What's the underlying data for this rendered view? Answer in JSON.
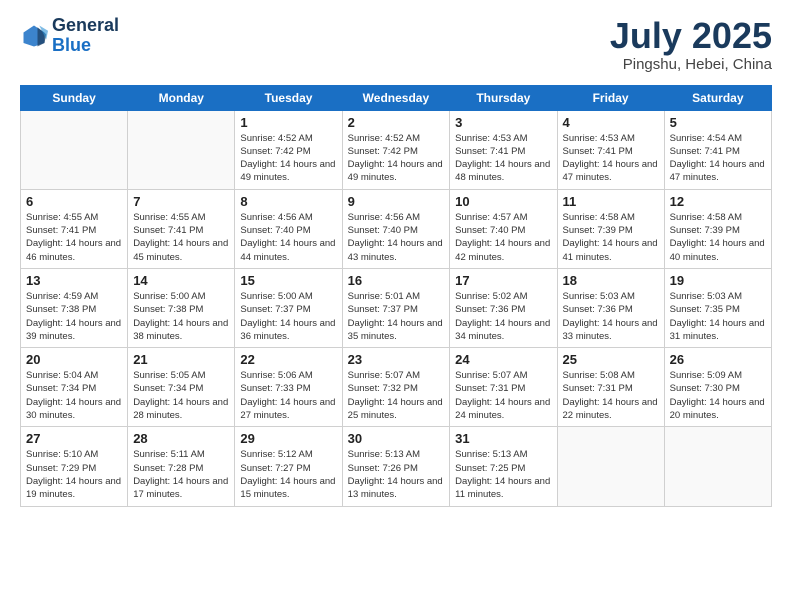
{
  "logo": {
    "general": "General",
    "blue": "Blue"
  },
  "title": {
    "month_year": "July 2025",
    "location": "Pingshu, Hebei, China"
  },
  "weekdays": [
    "Sunday",
    "Monday",
    "Tuesday",
    "Wednesday",
    "Thursday",
    "Friday",
    "Saturday"
  ],
  "weeks": [
    [
      {
        "day": "",
        "info": ""
      },
      {
        "day": "",
        "info": ""
      },
      {
        "day": "1",
        "info": "Sunrise: 4:52 AM\nSunset: 7:42 PM\nDaylight: 14 hours and 49 minutes."
      },
      {
        "day": "2",
        "info": "Sunrise: 4:52 AM\nSunset: 7:42 PM\nDaylight: 14 hours and 49 minutes."
      },
      {
        "day": "3",
        "info": "Sunrise: 4:53 AM\nSunset: 7:41 PM\nDaylight: 14 hours and 48 minutes."
      },
      {
        "day": "4",
        "info": "Sunrise: 4:53 AM\nSunset: 7:41 PM\nDaylight: 14 hours and 47 minutes."
      },
      {
        "day": "5",
        "info": "Sunrise: 4:54 AM\nSunset: 7:41 PM\nDaylight: 14 hours and 47 minutes."
      }
    ],
    [
      {
        "day": "6",
        "info": "Sunrise: 4:55 AM\nSunset: 7:41 PM\nDaylight: 14 hours and 46 minutes."
      },
      {
        "day": "7",
        "info": "Sunrise: 4:55 AM\nSunset: 7:41 PM\nDaylight: 14 hours and 45 minutes."
      },
      {
        "day": "8",
        "info": "Sunrise: 4:56 AM\nSunset: 7:40 PM\nDaylight: 14 hours and 44 minutes."
      },
      {
        "day": "9",
        "info": "Sunrise: 4:56 AM\nSunset: 7:40 PM\nDaylight: 14 hours and 43 minutes."
      },
      {
        "day": "10",
        "info": "Sunrise: 4:57 AM\nSunset: 7:40 PM\nDaylight: 14 hours and 42 minutes."
      },
      {
        "day": "11",
        "info": "Sunrise: 4:58 AM\nSunset: 7:39 PM\nDaylight: 14 hours and 41 minutes."
      },
      {
        "day": "12",
        "info": "Sunrise: 4:58 AM\nSunset: 7:39 PM\nDaylight: 14 hours and 40 minutes."
      }
    ],
    [
      {
        "day": "13",
        "info": "Sunrise: 4:59 AM\nSunset: 7:38 PM\nDaylight: 14 hours and 39 minutes."
      },
      {
        "day": "14",
        "info": "Sunrise: 5:00 AM\nSunset: 7:38 PM\nDaylight: 14 hours and 38 minutes."
      },
      {
        "day": "15",
        "info": "Sunrise: 5:00 AM\nSunset: 7:37 PM\nDaylight: 14 hours and 36 minutes."
      },
      {
        "day": "16",
        "info": "Sunrise: 5:01 AM\nSunset: 7:37 PM\nDaylight: 14 hours and 35 minutes."
      },
      {
        "day": "17",
        "info": "Sunrise: 5:02 AM\nSunset: 7:36 PM\nDaylight: 14 hours and 34 minutes."
      },
      {
        "day": "18",
        "info": "Sunrise: 5:03 AM\nSunset: 7:36 PM\nDaylight: 14 hours and 33 minutes."
      },
      {
        "day": "19",
        "info": "Sunrise: 5:03 AM\nSunset: 7:35 PM\nDaylight: 14 hours and 31 minutes."
      }
    ],
    [
      {
        "day": "20",
        "info": "Sunrise: 5:04 AM\nSunset: 7:34 PM\nDaylight: 14 hours and 30 minutes."
      },
      {
        "day": "21",
        "info": "Sunrise: 5:05 AM\nSunset: 7:34 PM\nDaylight: 14 hours and 28 minutes."
      },
      {
        "day": "22",
        "info": "Sunrise: 5:06 AM\nSunset: 7:33 PM\nDaylight: 14 hours and 27 minutes."
      },
      {
        "day": "23",
        "info": "Sunrise: 5:07 AM\nSunset: 7:32 PM\nDaylight: 14 hours and 25 minutes."
      },
      {
        "day": "24",
        "info": "Sunrise: 5:07 AM\nSunset: 7:31 PM\nDaylight: 14 hours and 24 minutes."
      },
      {
        "day": "25",
        "info": "Sunrise: 5:08 AM\nSunset: 7:31 PM\nDaylight: 14 hours and 22 minutes."
      },
      {
        "day": "26",
        "info": "Sunrise: 5:09 AM\nSunset: 7:30 PM\nDaylight: 14 hours and 20 minutes."
      }
    ],
    [
      {
        "day": "27",
        "info": "Sunrise: 5:10 AM\nSunset: 7:29 PM\nDaylight: 14 hours and 19 minutes."
      },
      {
        "day": "28",
        "info": "Sunrise: 5:11 AM\nSunset: 7:28 PM\nDaylight: 14 hours and 17 minutes."
      },
      {
        "day": "29",
        "info": "Sunrise: 5:12 AM\nSunset: 7:27 PM\nDaylight: 14 hours and 15 minutes."
      },
      {
        "day": "30",
        "info": "Sunrise: 5:13 AM\nSunset: 7:26 PM\nDaylight: 14 hours and 13 minutes."
      },
      {
        "day": "31",
        "info": "Sunrise: 5:13 AM\nSunset: 7:25 PM\nDaylight: 14 hours and 11 minutes."
      },
      {
        "day": "",
        "info": ""
      },
      {
        "day": "",
        "info": ""
      }
    ]
  ]
}
